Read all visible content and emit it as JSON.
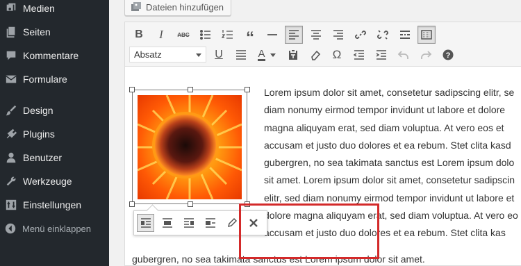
{
  "sidebar": {
    "items": [
      {
        "label": "Medien",
        "icon": "media-icon"
      },
      {
        "label": "Seiten",
        "icon": "pages-icon"
      },
      {
        "label": "Kommentare",
        "icon": "comments-icon"
      },
      {
        "label": "Formulare",
        "icon": "mail-icon"
      },
      {
        "label": "Design",
        "icon": "brush-icon"
      },
      {
        "label": "Plugins",
        "icon": "plugin-icon"
      },
      {
        "label": "Benutzer",
        "icon": "user-icon"
      },
      {
        "label": "Werkzeuge",
        "icon": "wrench-icon"
      },
      {
        "label": "Einstellungen",
        "icon": "settings-icon"
      }
    ],
    "collapse_label": "Menü einklappen"
  },
  "editor": {
    "add_media_label": "Dateien hinzufügen",
    "format_select_value": "Absatz",
    "toolbar_row1": [
      "bold-icon",
      "italic-icon",
      "strikethrough-icon",
      "bullet-list-icon",
      "numbered-list-icon",
      "quote-icon",
      "horizontal-line-icon",
      "align-left-icon",
      "align-center-icon",
      "align-right-icon",
      "link-icon",
      "unlink-icon",
      "read-more-icon",
      "toolbar-toggle-icon"
    ],
    "toolbar_row2": [
      "underline-icon",
      "justify-icon",
      "text-color-icon",
      "paste-text-icon",
      "clear-format-icon",
      "special-char-icon",
      "outdent-icon",
      "indent-icon",
      "undo-icon",
      "redo-icon",
      "help-icon"
    ]
  },
  "content": {
    "lines": [
      "Lorem ipsum dolor sit amet, consetetur sadipscing elitr, se",
      "diam nonumy eirmod tempor invidunt ut labore et dolore",
      "magna aliquyam erat, sed diam voluptua. At vero eos et",
      "accusam et justo duo dolores et ea rebum. Stet clita kasd",
      "gubergren, no sea takimata sanctus est Lorem ipsum dolo",
      "sit amet. Lorem ipsum dolor sit amet, consetetur sadipscin",
      "elitr, sed diam nonumy eirmod tempor invidunt ut labore et",
      "dolore magna aliquyam erat, sed diam voluptua. At vero eo",
      "accusam et justo duo dolores et ea rebum. Stet clita kas"
    ],
    "last_line": "gubergren, no sea takimata sanctus est Lorem ipsum dolor sit amet."
  },
  "image_toolbar": {
    "buttons": [
      "align-left-icon",
      "align-center-icon",
      "align-right-icon",
      "align-none-icon",
      "edit-pencil-icon",
      "remove-x-icon"
    ],
    "active_index": 0
  },
  "colors": {
    "sidebar_bg": "#23282d",
    "highlight_red": "#d32a2a"
  }
}
